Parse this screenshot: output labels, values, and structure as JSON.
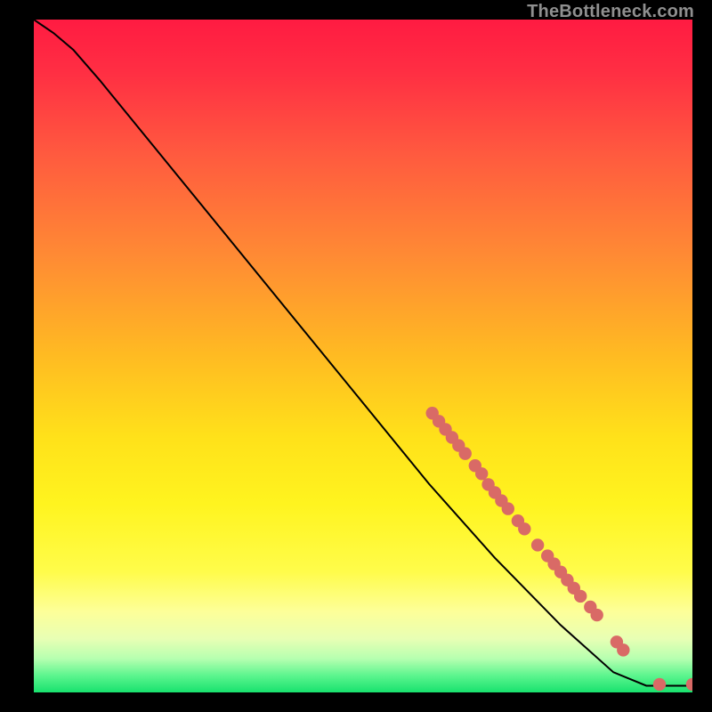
{
  "watermark": "TheBottleneck.com",
  "chart_data": {
    "type": "line",
    "xlim": [
      0,
      100
    ],
    "ylim": [
      0,
      100
    ],
    "xlabel": "",
    "ylabel": "",
    "title": "",
    "curve": [
      {
        "x": 0,
        "y": 100
      },
      {
        "x": 3,
        "y": 98
      },
      {
        "x": 6,
        "y": 95.5
      },
      {
        "x": 10,
        "y": 91
      },
      {
        "x": 20,
        "y": 79
      },
      {
        "x": 30,
        "y": 67
      },
      {
        "x": 40,
        "y": 55
      },
      {
        "x": 50,
        "y": 43
      },
      {
        "x": 60,
        "y": 31
      },
      {
        "x": 70,
        "y": 20
      },
      {
        "x": 80,
        "y": 10
      },
      {
        "x": 88,
        "y": 3
      },
      {
        "x": 93,
        "y": 1
      },
      {
        "x": 95,
        "y": 1
      },
      {
        "x": 100,
        "y": 1
      }
    ],
    "points": [
      {
        "x": 60.5,
        "y": 41.5
      },
      {
        "x": 61.5,
        "y": 40.3
      },
      {
        "x": 62.5,
        "y": 39.1
      },
      {
        "x": 63.5,
        "y": 37.9
      },
      {
        "x": 64.5,
        "y": 36.7
      },
      {
        "x": 65.5,
        "y": 35.5
      },
      {
        "x": 67.0,
        "y": 33.7
      },
      {
        "x": 68.0,
        "y": 32.5
      },
      {
        "x": 69.0,
        "y": 30.9
      },
      {
        "x": 70.0,
        "y": 29.7
      },
      {
        "x": 71.0,
        "y": 28.5
      },
      {
        "x": 72.0,
        "y": 27.3
      },
      {
        "x": 73.5,
        "y": 25.5
      },
      {
        "x": 74.5,
        "y": 24.3
      },
      {
        "x": 76.5,
        "y": 21.9
      },
      {
        "x": 78.0,
        "y": 20.3
      },
      {
        "x": 79.0,
        "y": 19.1
      },
      {
        "x": 80.0,
        "y": 17.9
      },
      {
        "x": 81.0,
        "y": 16.7
      },
      {
        "x": 82.0,
        "y": 15.5
      },
      {
        "x": 83.0,
        "y": 14.3
      },
      {
        "x": 84.5,
        "y": 12.7
      },
      {
        "x": 85.5,
        "y": 11.5
      },
      {
        "x": 88.5,
        "y": 7.5
      },
      {
        "x": 89.5,
        "y": 6.3
      },
      {
        "x": 95.0,
        "y": 1.2
      },
      {
        "x": 100.0,
        "y": 1.2
      }
    ],
    "gradient_stops": [
      {
        "offset": 0.0,
        "color": "#ff1b42"
      },
      {
        "offset": 0.08,
        "color": "#ff2f43"
      },
      {
        "offset": 0.2,
        "color": "#ff5a3f"
      },
      {
        "offset": 0.35,
        "color": "#ff8a34"
      },
      {
        "offset": 0.5,
        "color": "#ffbb22"
      },
      {
        "offset": 0.62,
        "color": "#ffe11a"
      },
      {
        "offset": 0.72,
        "color": "#fff41f"
      },
      {
        "offset": 0.82,
        "color": "#fffc4a"
      },
      {
        "offset": 0.88,
        "color": "#fdff99"
      },
      {
        "offset": 0.92,
        "color": "#e8ffb4"
      },
      {
        "offset": 0.95,
        "color": "#b6ffb0"
      },
      {
        "offset": 0.975,
        "color": "#5cf58e"
      },
      {
        "offset": 1.0,
        "color": "#18e26e"
      }
    ],
    "point_color": "#d96a66",
    "curve_color": "#000000"
  }
}
